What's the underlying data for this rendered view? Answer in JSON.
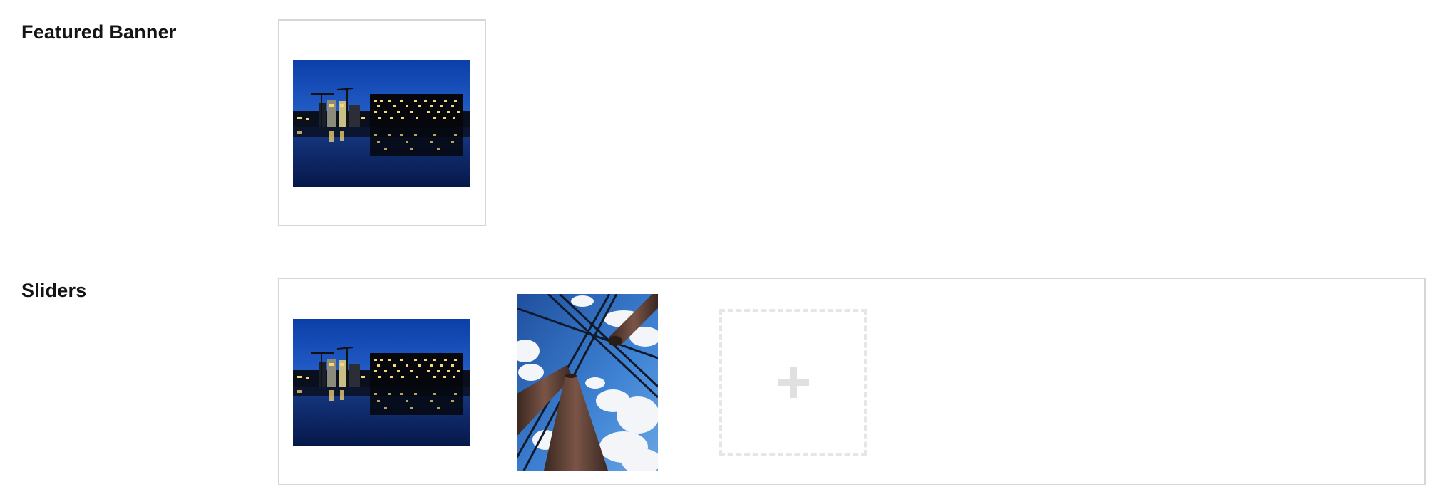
{
  "sections": {
    "featured_banner": {
      "label": "Featured Banner",
      "images": [
        {
          "icon": "city-night-waterfront-image"
        }
      ]
    },
    "sliders": {
      "label": "Sliders",
      "images": [
        {
          "icon": "city-night-waterfront-image"
        },
        {
          "icon": "chimneys-sky-image"
        }
      ],
      "add_button": {
        "icon": "plus-icon"
      }
    }
  },
  "colors": {
    "frame_border": "#d6d6d6",
    "divider": "#ececec",
    "add_tile_border": "#e6e6e6",
    "plus": "#e0e0e0",
    "label_text": "#141414"
  }
}
